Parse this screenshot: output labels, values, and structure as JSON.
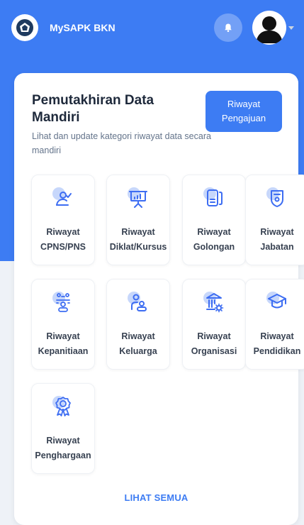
{
  "header": {
    "app_title": "MySAPK BKN",
    "logo_icon": "bkn-logo-icon",
    "notification_icon": "bell-icon",
    "avatar_icon": "user-avatar-icon"
  },
  "card": {
    "title": "Pemutakhiran Data Mandiri",
    "subtitle": "Lihat dan update kategori riwayat data secara mandiri",
    "pengajuan_button": "Riwayat Pengajuan",
    "see_all": "LIHAT SEMUA"
  },
  "tiles": [
    {
      "line1": "Riwayat",
      "line2": "CPNS/PNS",
      "icon": "user-check-icon"
    },
    {
      "line1": "Riwayat",
      "line2": "Diklat/Kursus",
      "icon": "presentation-board-icon"
    },
    {
      "line1": "Riwayat",
      "line2": "Golongan",
      "icon": "id-card-icon"
    },
    {
      "line1": "Riwayat",
      "line2": "Jabatan",
      "icon": "badge-shield-icon"
    },
    {
      "line1": "Riwayat",
      "line2": "Kepanitiaan",
      "icon": "team-meeting-icon"
    },
    {
      "line1": "Riwayat",
      "line2": "Keluarga",
      "icon": "family-icon"
    },
    {
      "line1": "Riwayat",
      "line2": "Organisasi",
      "icon": "building-gear-icon"
    },
    {
      "line1": "Riwayat",
      "line2": "Pendidikan",
      "icon": "graduation-cap-icon"
    },
    {
      "line1": "Riwayat",
      "line2": "Penghargaan",
      "icon": "award-medal-icon"
    }
  ],
  "colors": {
    "primary": "#3d7cf3",
    "icon_stroke": "#3d6df2",
    "icon_blob": "#c7d7fb"
  }
}
